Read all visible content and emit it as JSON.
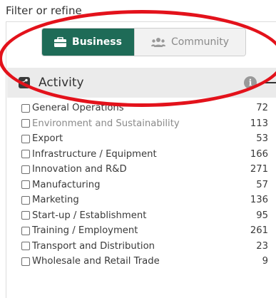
{
  "heading": "Filter or refine",
  "segmented": {
    "business_label": "Business",
    "community_label": "Community"
  },
  "section": {
    "title": "Activity",
    "info_symbol": "i"
  },
  "items": [
    {
      "label": "General Operations",
      "count": "72"
    },
    {
      "label": "Environment and Sustainability",
      "count": "113"
    },
    {
      "label": "Export",
      "count": "53"
    },
    {
      "label": "Infrastructure / Equipment",
      "count": "166"
    },
    {
      "label": "Innovation and R&D",
      "count": "271"
    },
    {
      "label": "Manufacturing",
      "count": "57"
    },
    {
      "label": "Marketing",
      "count": "136"
    },
    {
      "label": "Start-up / Establishment",
      "count": "95"
    },
    {
      "label": "Training / Employment",
      "count": "261"
    },
    {
      "label": "Transport and Distribution",
      "count": "23"
    },
    {
      "label": "Wholesale and Retail Trade",
      "count": "9"
    }
  ],
  "colors": {
    "active_green": "#1e6b57",
    "annotation_red": "#e3121b"
  }
}
